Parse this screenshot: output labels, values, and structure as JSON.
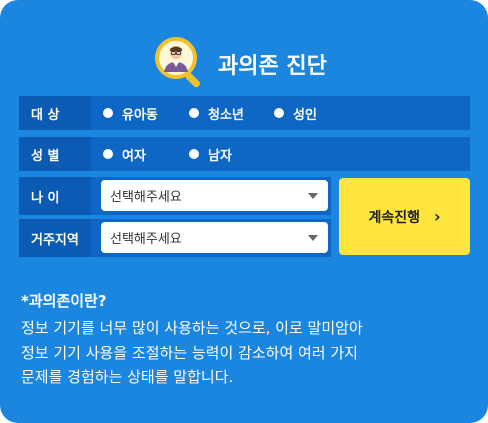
{
  "header": {
    "title": "과의존 진단",
    "logo_icon": "magnifier-person-icon"
  },
  "target": {
    "label": "대 상",
    "options": [
      "유아동",
      "청소년",
      "성인"
    ]
  },
  "gender": {
    "label": "성 별",
    "options": [
      "여자",
      "남자"
    ]
  },
  "age": {
    "label": "나 이",
    "placeholder": "선택해주세요"
  },
  "region": {
    "label": "거주지역",
    "placeholder": "선택해주세요"
  },
  "next_button": {
    "label": "계속진행",
    "arrow": "›"
  },
  "description": {
    "title": "*과의존이란?",
    "lines": [
      "정보 기기를 너무 많이 사용하는 것으로, 이로 말미암아",
      "정보 기기 사용을 조절하는 능력이 감소하여 여러 가지",
      "문제를 경험하는 상태를 말합니다."
    ]
  },
  "colors": {
    "background": "#1b86e0",
    "row": "#0f67c5",
    "label_bg": "#0b5bb4",
    "button": "#ffe53d"
  }
}
